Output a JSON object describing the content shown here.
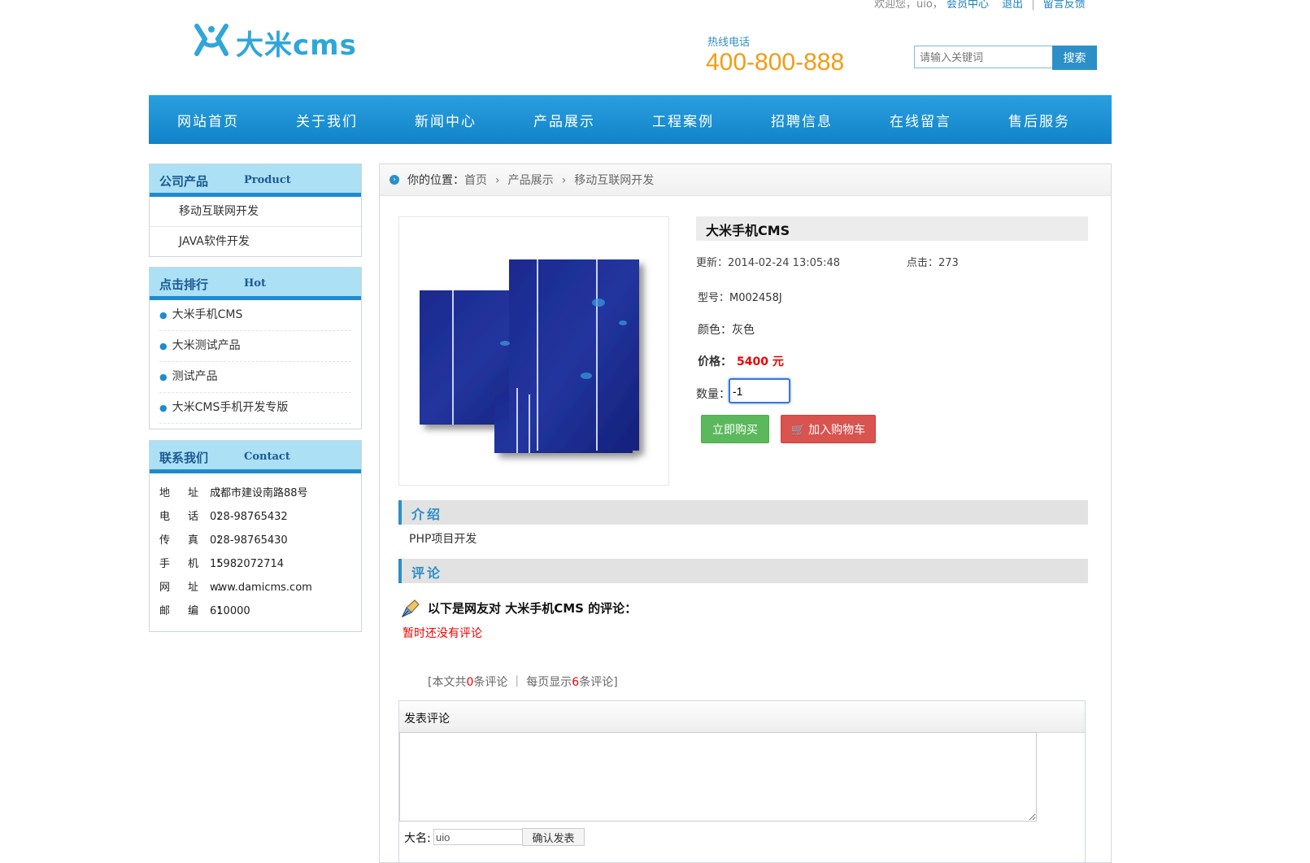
{
  "topbar": {
    "welcome": "欢迎您，uio，",
    "member": "会员中心",
    "logout": "退出",
    "sep": "|",
    "feedback": "留言反馈"
  },
  "header": {
    "logo_text": "大米cms",
    "hotline_label": "热线电话",
    "hotline_number": "400-800-888"
  },
  "search": {
    "placeholder": "请输入关键词",
    "button": "搜索"
  },
  "nav": [
    "网站首页",
    "关于我们",
    "新闻中心",
    "产品展示",
    "工程案例",
    "招聘信息",
    "在线留言",
    "售后服务"
  ],
  "sidebar": {
    "products": {
      "title_cn": "公司产品",
      "title_en": "Product",
      "items": [
        "移动互联网开发",
        "JAVA软件开发"
      ]
    },
    "hot": {
      "title_cn": "点击排行",
      "title_en": "Hot",
      "items": [
        "大米手机CMS",
        "大米测试产品",
        "测试产品",
        "大米CMS手机开发专版"
      ]
    },
    "contact": {
      "title_cn": "联系我们",
      "title_en": "Contact",
      "rows": [
        {
          "k": "地址：",
          "v": "成都市建设南路88号"
        },
        {
          "k": "电话：",
          "v": "028-98765432"
        },
        {
          "k": "传真：",
          "v": "028-98765430"
        },
        {
          "k": "手机：",
          "v": "15982072714"
        },
        {
          "k": "网址：",
          "v": "www.damicms.com"
        },
        {
          "k": "邮编：",
          "v": "610000"
        }
      ]
    }
  },
  "breadcrumb": {
    "label": "你的位置：",
    "items": [
      "首页",
      "产品展示",
      "移动互联网开发"
    ]
  },
  "product": {
    "title": "大米手机CMS",
    "update": "更新：2014-02-24 13:05:48",
    "hits": "点击：273",
    "model": "型号：M002458J",
    "color": "颜色：灰色",
    "price_label": "价格：",
    "price": "5400 元",
    "qty_label": "数量：",
    "qty_value": "-1",
    "buy_button": "立即购买",
    "cart_button": "加入购物车"
  },
  "intro": {
    "heading": "介绍",
    "text": "PHP项目开发"
  },
  "comments": {
    "heading": "评论",
    "title": "以下是网友对 大米手机CMS 的评论：",
    "empty": "暂时还没有评论",
    "stats_prefix": "[本文共",
    "stats_count": "0",
    "stats_mid": "条评论 ｜ 每页显示",
    "stats_per_page": "6",
    "stats_suffix": "条评论]",
    "form_title": "发表评论",
    "name_label": "大名:",
    "name_value": "uio",
    "submit": "确认发表"
  },
  "icons": {
    "crumb": "circle-arrow-icon",
    "comment": "pen-icon",
    "cart": "cart-icon"
  },
  "colors": {
    "nav": "#1a8fd4",
    "accent": "#2c8fc8",
    "price": "#ee0000",
    "buy": "#5cb85c",
    "cart": "#d9534f"
  }
}
